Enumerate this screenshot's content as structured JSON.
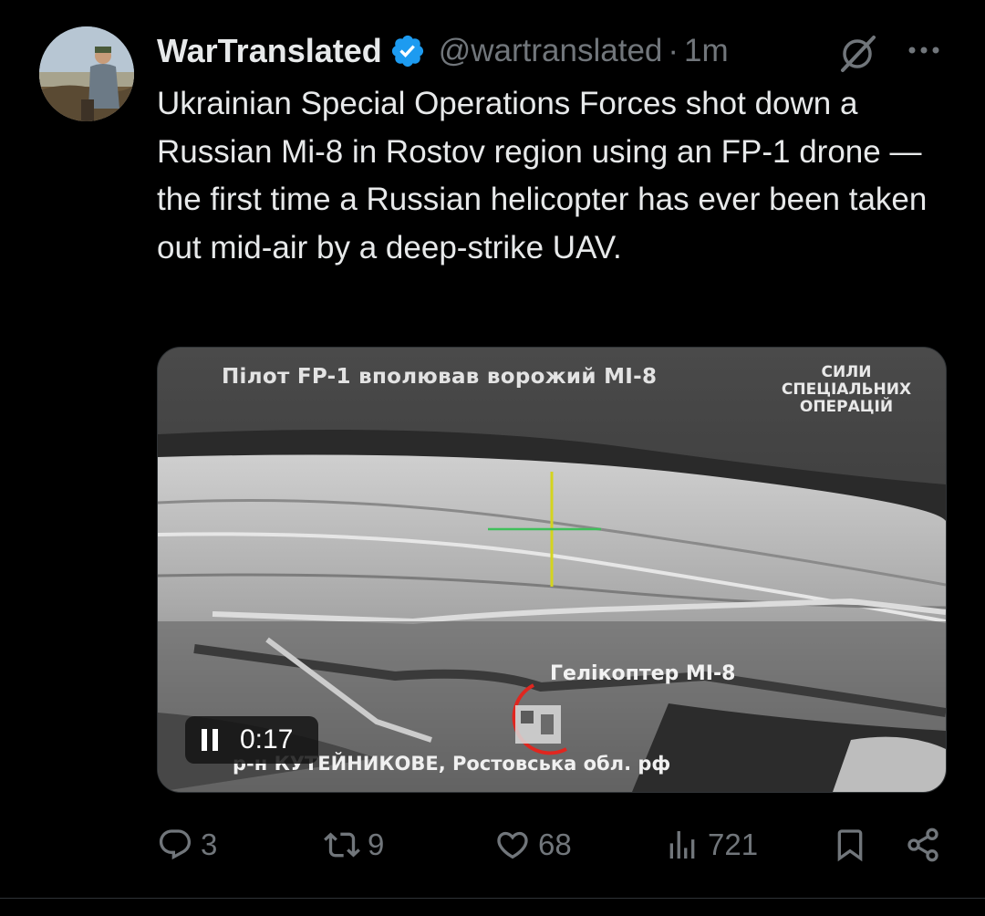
{
  "author": {
    "name": "WarTranslated",
    "handle": "@wartranslated",
    "separator": "·",
    "time": "1m",
    "verified": true
  },
  "tweet": {
    "text": "Ukrainian Special Operations Forces shot down a Russian Mi-8 in Rostov region using an FP-1 drone — the first time a Russian helicopter has ever been taken out mid-air by a deep-strike UAV."
  },
  "media": {
    "overlay_title": "Пілот FP-1 вполював ворожий МІ-8",
    "logo_lines": [
      "СИЛИ",
      "СПЕЦІАЛЬНИХ",
      "ОПЕРАЦІЙ"
    ],
    "target_label": "Гелікоптер МІ-8",
    "location_label": "р-н КУТЕЙНИКОВЕ, Ростовська обл. рф",
    "playback_time": "0:17",
    "playback_state": "pause-icon"
  },
  "actions": {
    "replies": "3",
    "reposts": "9",
    "likes": "68",
    "views": "721"
  },
  "colors": {
    "background": "#000000",
    "text_primary": "#e7e9ea",
    "text_secondary": "#71767b",
    "verified_badge": "#1d9bf0",
    "reticle_vertical": "#d4d41e",
    "reticle_horizontal": "#3fbf5a",
    "target_circle": "#e0261f"
  },
  "icons": {
    "verified": "verified-badge-icon",
    "grok": "grok-icon",
    "more": "more-icon",
    "reply": "reply-icon",
    "repost": "repost-icon",
    "like": "heart-icon",
    "views": "views-icon",
    "bookmark": "bookmark-icon",
    "share": "share-icon"
  }
}
